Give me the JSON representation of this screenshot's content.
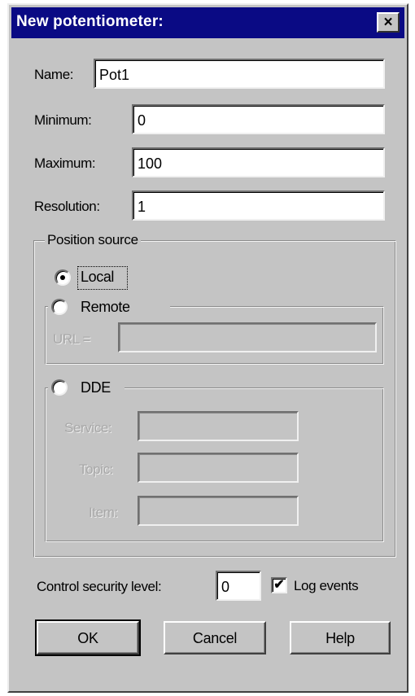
{
  "window": {
    "title": "New potentiometer:",
    "close_glyph": "×"
  },
  "fields": {
    "name_label": "Name:",
    "name_value": "Pot1",
    "minimum_label": "Minimum:",
    "minimum_value": "0",
    "maximum_label": "Maximum:",
    "maximum_value": "100",
    "resolution_label": "Resolution:",
    "resolution_value": "1"
  },
  "position_source": {
    "legend": "Position source",
    "local_label": "Local",
    "local_selected": true,
    "remote_label": "Remote",
    "url_label": "URL =",
    "url_value": "",
    "dde_label": "DDE",
    "service_label": "Service:",
    "service_value": "",
    "topic_label": "Topic:",
    "topic_value": "",
    "item_label": "Item:",
    "item_value": ""
  },
  "security": {
    "label": "Control security level:",
    "value": "0",
    "log_events_label": "Log events",
    "log_events_checked": true,
    "check_glyph": "✔"
  },
  "buttons": {
    "ok": "OK",
    "cancel": "Cancel",
    "help": "Help"
  },
  "colors": {
    "titlebar": "#0a0a84",
    "face": "#c4c4c4"
  }
}
